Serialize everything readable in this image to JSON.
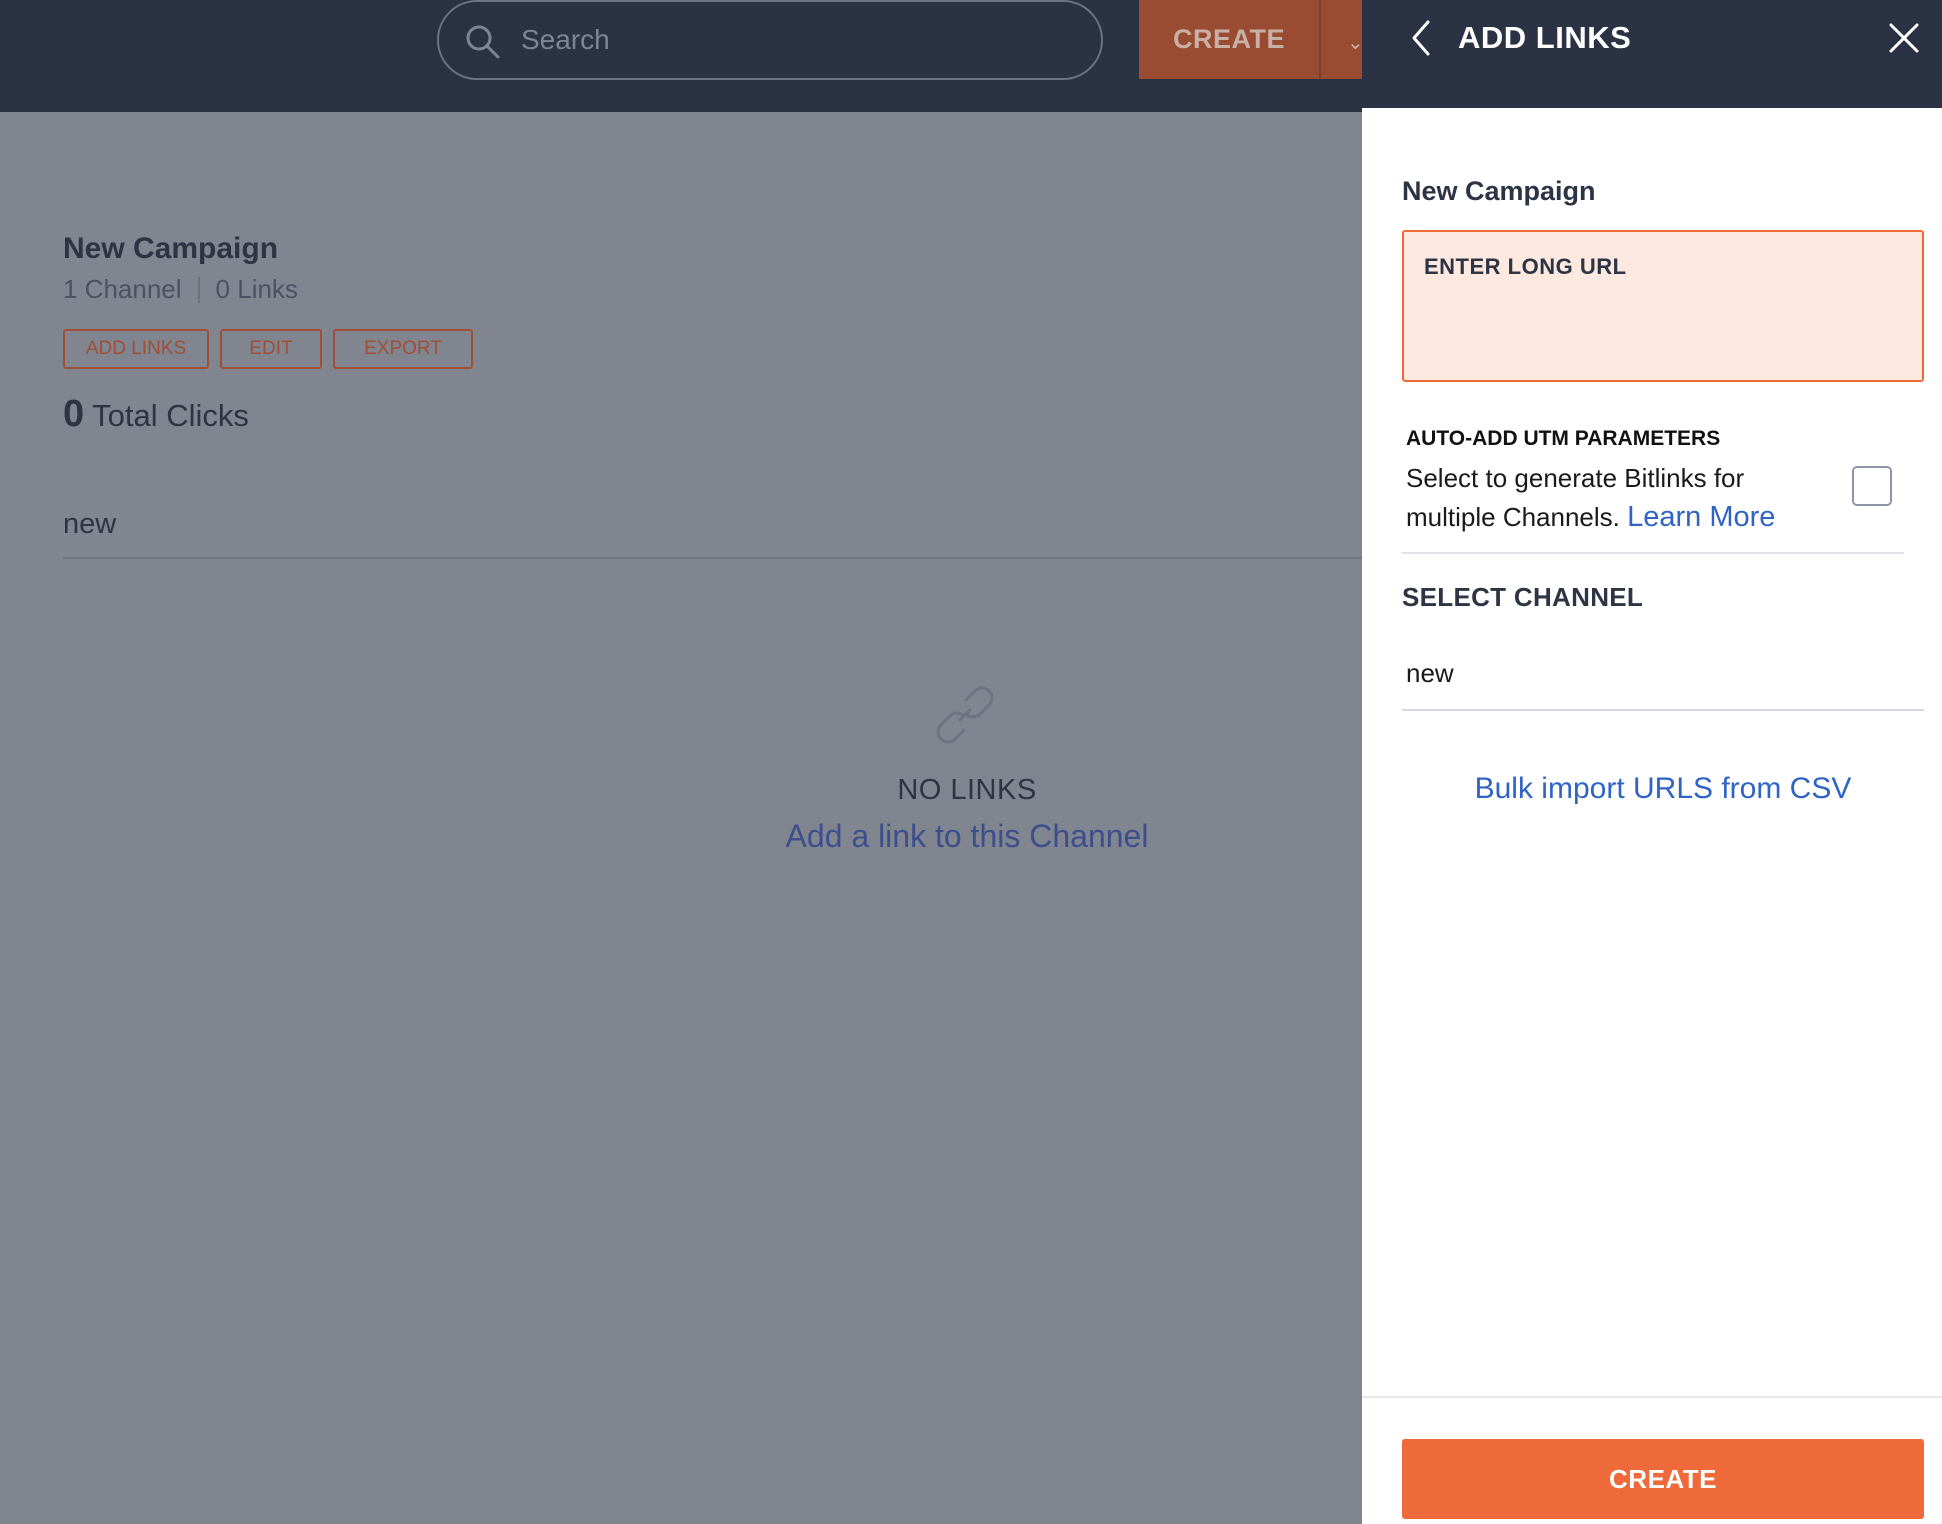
{
  "header": {
    "search_placeholder": "Search",
    "create_label": "CREATE",
    "create_dropdown_icon": "chevron-down-icon"
  },
  "campaign": {
    "title": "New Campaign",
    "channels": "1 Channel",
    "links": "0 Links",
    "actions": [
      "ADD LINKS",
      "EDIT",
      "EXPORT"
    ],
    "total_clicks_value": "0",
    "total_clicks_label": "Total Clicks",
    "channel_tab": "new",
    "empty_state": {
      "icon": "link-icon",
      "title": "NO LINKS",
      "cta": "Add a link to this Channel"
    }
  },
  "drawer": {
    "title": "ADD LINKS",
    "campaign_name": "New Campaign",
    "url_placeholder": "ENTER LONG URL",
    "utm": {
      "title": "AUTO-ADD UTM PARAMETERS",
      "description": "Select to generate Bitlinks for multiple Channels.",
      "learn_more": "Learn More",
      "checked": false
    },
    "select_channel_label": "SELECT CHANNEL",
    "selected_channel": "new",
    "bulk_import": "Bulk import URLS from CSV",
    "create_label": "CREATE"
  },
  "colors": {
    "topbar": "#2b3243",
    "accent": "#ee6a3a",
    "link": "#2f64c6",
    "overlay": "#80858f"
  }
}
